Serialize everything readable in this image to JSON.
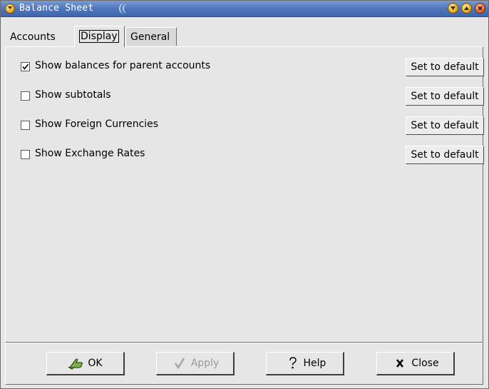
{
  "window": {
    "title": "Balance Sheet"
  },
  "tabs": [
    {
      "label": "Accounts"
    },
    {
      "label": "Display",
      "selected": true
    },
    {
      "label": "General"
    }
  ],
  "options": [
    {
      "label": "Show balances for parent accounts",
      "checked": true,
      "button": "Set to default"
    },
    {
      "label": "Show subtotals",
      "checked": false,
      "button": "Set to default"
    },
    {
      "label": "Show Foreign Currencies",
      "checked": false,
      "button": "Set to default"
    },
    {
      "label": "Show Exchange Rates",
      "checked": false,
      "button": "Set to default"
    }
  ],
  "buttons": {
    "ok": "OK",
    "apply": "Apply",
    "help": "Help",
    "close": "Close"
  },
  "icons": {
    "menu": "window-menu-icon",
    "minimize": "minimize-icon",
    "maximize": "maximize-icon",
    "close": "close-icon",
    "ok": "ok-hand-icon",
    "apply": "checkmark-icon",
    "help": "question-mark-icon",
    "close_btn": "x-icon"
  },
  "colors": {
    "titlebar": "#4f77bd",
    "window_bg": "#e6e6e6"
  }
}
